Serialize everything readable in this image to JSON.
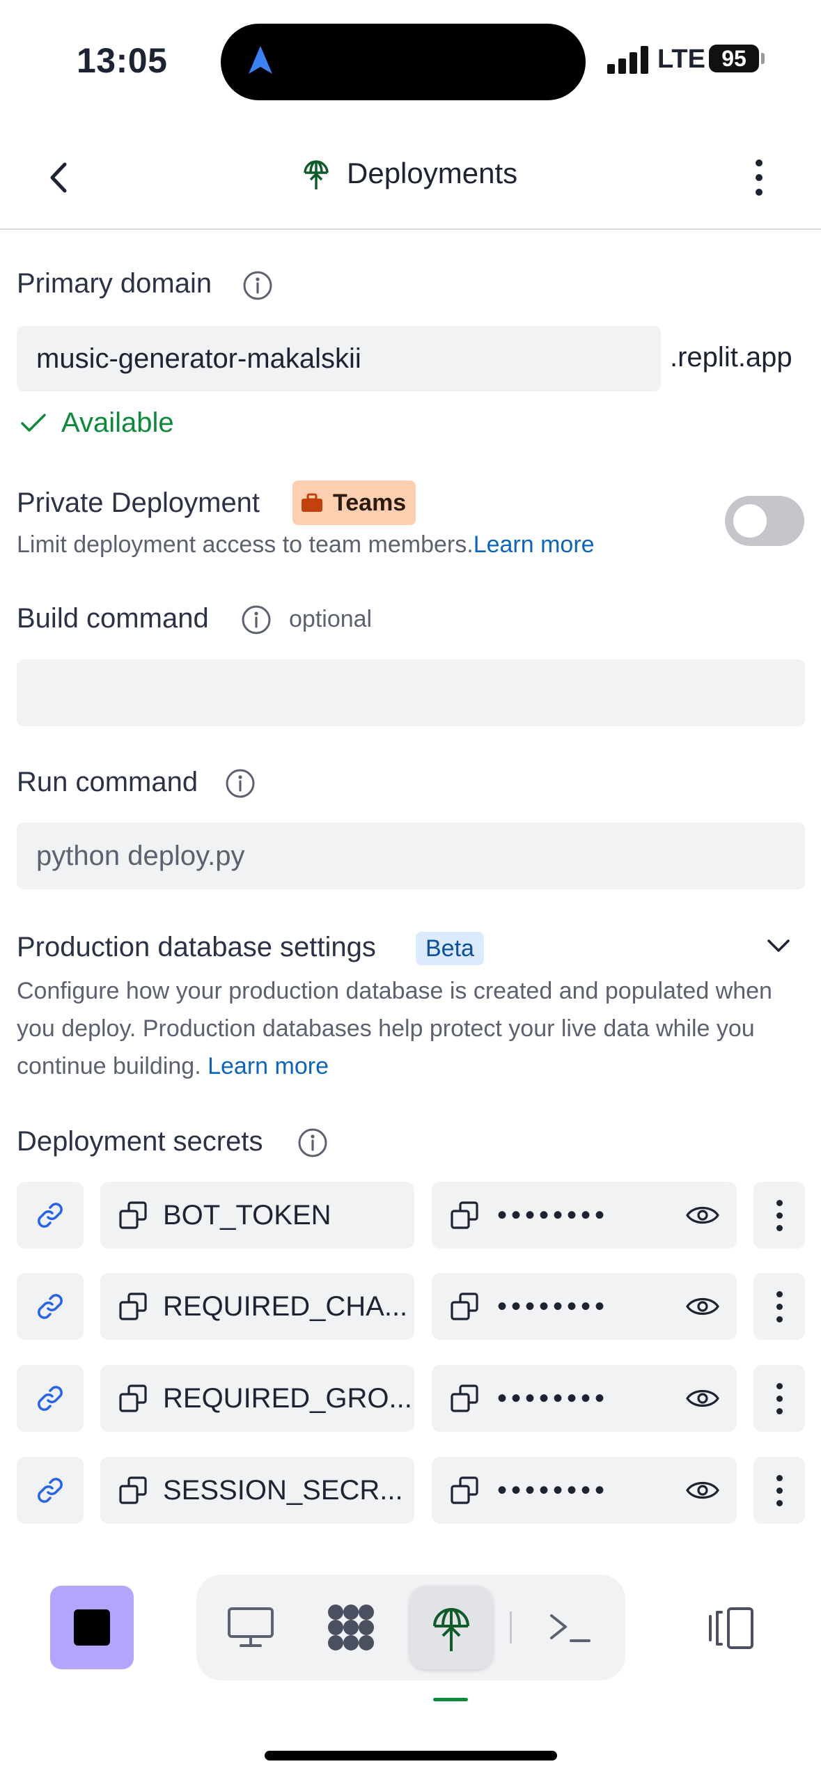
{
  "status_bar": {
    "time": "13:05",
    "network": "LTE",
    "battery": "95"
  },
  "header": {
    "title": "Deployments"
  },
  "primary_domain": {
    "label": "Primary domain",
    "value": "music-generator-makalskii",
    "suffix": ".replit.app",
    "status": "Available"
  },
  "private_deployment": {
    "label": "Private Deployment",
    "badge": "Teams",
    "description": "Limit deployment access to team members.",
    "learn_more": "Learn more",
    "enabled": false
  },
  "build_command": {
    "label": "Build command",
    "optional": "optional",
    "value": ""
  },
  "run_command": {
    "label": "Run command",
    "value": "python deploy.py"
  },
  "production_db": {
    "label": "Production database settings",
    "badge": "Beta",
    "description": "Configure how your production database is created and populated when you deploy. Production databases help protect your live data while you continue building.",
    "learn_more": "Learn more"
  },
  "secrets": {
    "label": "Deployment secrets",
    "items": [
      {
        "key": "BOT_TOKEN",
        "value": "••••••••"
      },
      {
        "key": "REQUIRED_CHA...",
        "value": "••••••••"
      },
      {
        "key": "REQUIRED_GRO...",
        "value": "••••••••"
      },
      {
        "key": "SESSION_SECR...",
        "value": "••••••••"
      }
    ]
  },
  "toolbar": {
    "active_tab": "deployments",
    "accent": "#0d8a39",
    "stop_color": "#b4a5ff"
  }
}
